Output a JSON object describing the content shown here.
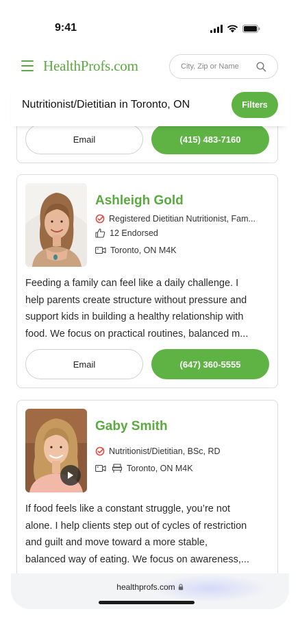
{
  "status_bar": {
    "time": "9:41"
  },
  "header": {
    "logo": "HealthProfs.com",
    "search_placeholder": "City, Zip or Name"
  },
  "title_bar": {
    "title": "Nutritionist/Dietitian in Toronto, ON",
    "filters_label": "Filters"
  },
  "previous_card": {
    "email_label": "Email",
    "phone": "(415) 483-7160"
  },
  "profiles": [
    {
      "name": "Ashleigh Gold",
      "credentials": "Registered Dietitian Nutritionist, Fam...",
      "endorsed": "12 Endorsed",
      "location": "Toronto, ON M4K",
      "bio_lines": [
        "Feeding a family can feel like a daily challenge. I",
        "help parents create structure without pressure and",
        "support kids in building a healthy relationship with",
        "food. We focus on practical routines, balanced m..."
      ],
      "email_label": "Email",
      "phone": "(647) 360-5555"
    },
    {
      "name": "Gaby Smith",
      "credentials": "Nutritionist/Dietitian, BSc, RD",
      "location": "Toronto, ON M4K",
      "bio_lines": [
        "If food feels like a constant struggle, you’re not",
        "alone. I help clients step out of cycles of restriction",
        "and guilt and move toward a more stable,",
        "balanced way of eating. We focus on awareness,..."
      ]
    }
  ],
  "browser": {
    "url": "healthprofs.com"
  },
  "colors": {
    "brand_green": "#5fb345",
    "logo_green": "#5aaa3f",
    "verified_red": "#e0453a"
  }
}
